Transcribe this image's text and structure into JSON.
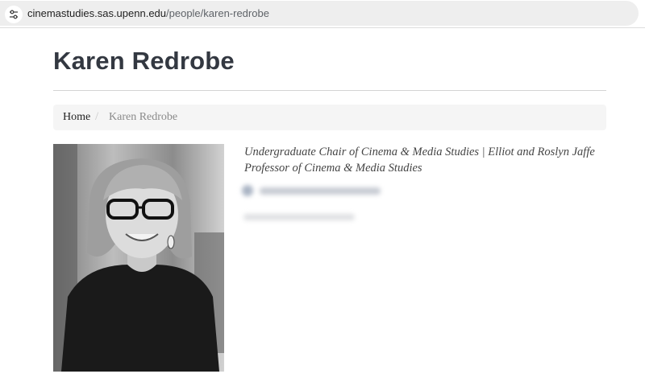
{
  "browser": {
    "url_host": "cinemastudies.sas.upenn.edu",
    "url_path": "/people/karen-redrobe",
    "site_info_icon": "tune-icon"
  },
  "page": {
    "title": "Karen Redrobe"
  },
  "breadcrumb": {
    "home": "Home",
    "separator": "/",
    "current": "Karen Redrobe"
  },
  "profile": {
    "photo_icon": "portrait-photo",
    "title_line_1": "Undergraduate Chair of Cinema & Media Studies | Elliot and Roslyn Jaffe",
    "title_line_2": "Professor of Cinema & Media Studies"
  }
}
